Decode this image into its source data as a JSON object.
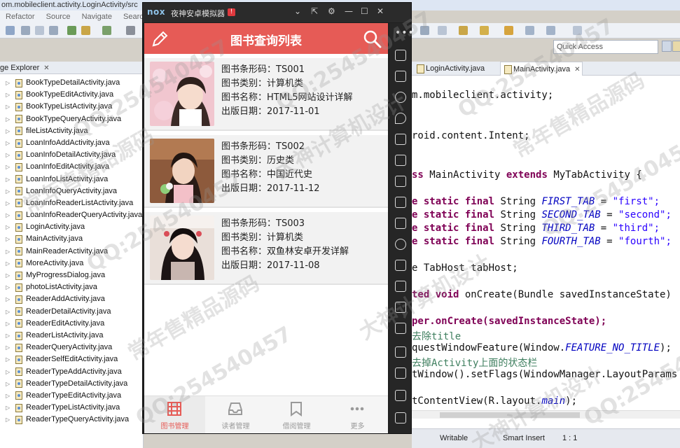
{
  "ide": {
    "title": "om.mobileclient.activity.LoginActivity/src",
    "menu": [
      "Refactor",
      "Source",
      "Navigate",
      "Search"
    ],
    "quick_access": "Quick Access",
    "package_explorer": {
      "tab_label": "ge Explorer",
      "files": [
        "BookTypeDetailActivity.java",
        "BookTypeEditActivity.java",
        "BookTypeListActivity.java",
        "BookTypeQueryActivity.java",
        "fileListActivity.java",
        "LoanInfoAddActivity.java",
        "LoanInfoDetailActivity.java",
        "LoanInfoEditActivity.java",
        "LoanInfoListActivity.java",
        "LoanInfoQueryActivity.java",
        "LoanInfoReaderListActivity.java",
        "LoanInfoReaderQueryActivity.java",
        "LoginActivity.java",
        "MainActivity.java",
        "MainReaderActivity.java",
        "MoreActivity.java",
        "MyProgressDialog.java",
        "photoListActivity.java",
        "ReaderAddActivity.java",
        "ReaderDetailActivity.java",
        "ReaderEditActivity.java",
        "ReaderListActivity.java",
        "ReaderQueryActivity.java",
        "ReaderSelfEditActivity.java",
        "ReaderTypeAddActivity.java",
        "ReaderTypeDetailActivity.java",
        "ReaderTypeEditActivity.java",
        "ReaderTypeListActivity.java",
        "ReaderTypeQueryActivity.java"
      ]
    },
    "editor_tabs": [
      "LoginActivity.java",
      "MainActivity.java"
    ],
    "code": {
      "l1": "m.mobileclient.activity;",
      "l2": "roid.content.Intent;",
      "l3a": "ss ",
      "l3b": "MainActivity ",
      "l3c": "extends ",
      "l3d": "MyTabActivity {",
      "static_final": "e static final",
      "string_t": " String ",
      "f1": "FIRST_TAB",
      "v1": "\"first\";",
      "f2": "SECOND_TAB",
      "v2": "\"second\";",
      "f3": "THIRD_TAB",
      "v3": "\"third\";",
      "f4": "FOURTH_TAB",
      "v4": "\"fourth\";",
      "eq": " = ",
      "tabhost": "e TabHost tabHost;",
      "oncreate_a": "ted void ",
      "oncreate_b": "onCreate(Bundle savedInstanceState)",
      "super": "per.onCreate(savedInstanceState);",
      "cmt1": "去除title",
      "req": "questWindowFeature(Window.",
      "req_f": "FEATURE_NO_TITLE",
      "req_end": ");",
      "cmt2": "去掉Activity上面的状态栏",
      "setw": "tWindow().setFlags(WindowManager.LayoutParams",
      "setc": "tContentView(R.layout.",
      "setc_f": "main",
      "setc_end": ");"
    },
    "status": {
      "writable": "Writable",
      "insert": "Smart Insert",
      "pos": "1 : 1"
    }
  },
  "emulator": {
    "logo": "nox",
    "name": "夜神安卓模拟器",
    "alert": "!"
  },
  "app": {
    "title": "图书查询列表",
    "books": [
      {
        "barcode_label": "图书条形码：",
        "barcode": "TS001",
        "type_label": "图书类别：",
        "type": "计算机类",
        "name_label": "图书名称：",
        "name": "HTML5网站设计详解",
        "date_label": "出版日期：",
        "date": "2017-11-01"
      },
      {
        "barcode_label": "图书条形码：",
        "barcode": "TS002",
        "type_label": "图书类别：",
        "type": "历史类",
        "name_label": "图书名称：",
        "name": "中国近代史",
        "date_label": "出版日期：",
        "date": "2017-11-12"
      },
      {
        "barcode_label": "图书条形码：",
        "barcode": "TS003",
        "type_label": "图书类别：",
        "type": "计算机类",
        "name_label": "图书名称：",
        "name": "双鱼林安卓开发详解",
        "date_label": "出版日期：",
        "date": "2017-11-08"
      }
    ],
    "nav": [
      "图书管理",
      "读者管理",
      "借阅管理",
      "更多"
    ],
    "accent": "#e65b56"
  },
  "watermarks": {
    "qq": "QQ:254540457",
    "cn1": "常年售精品源码",
    "cn2": "大神计算机设计"
  }
}
